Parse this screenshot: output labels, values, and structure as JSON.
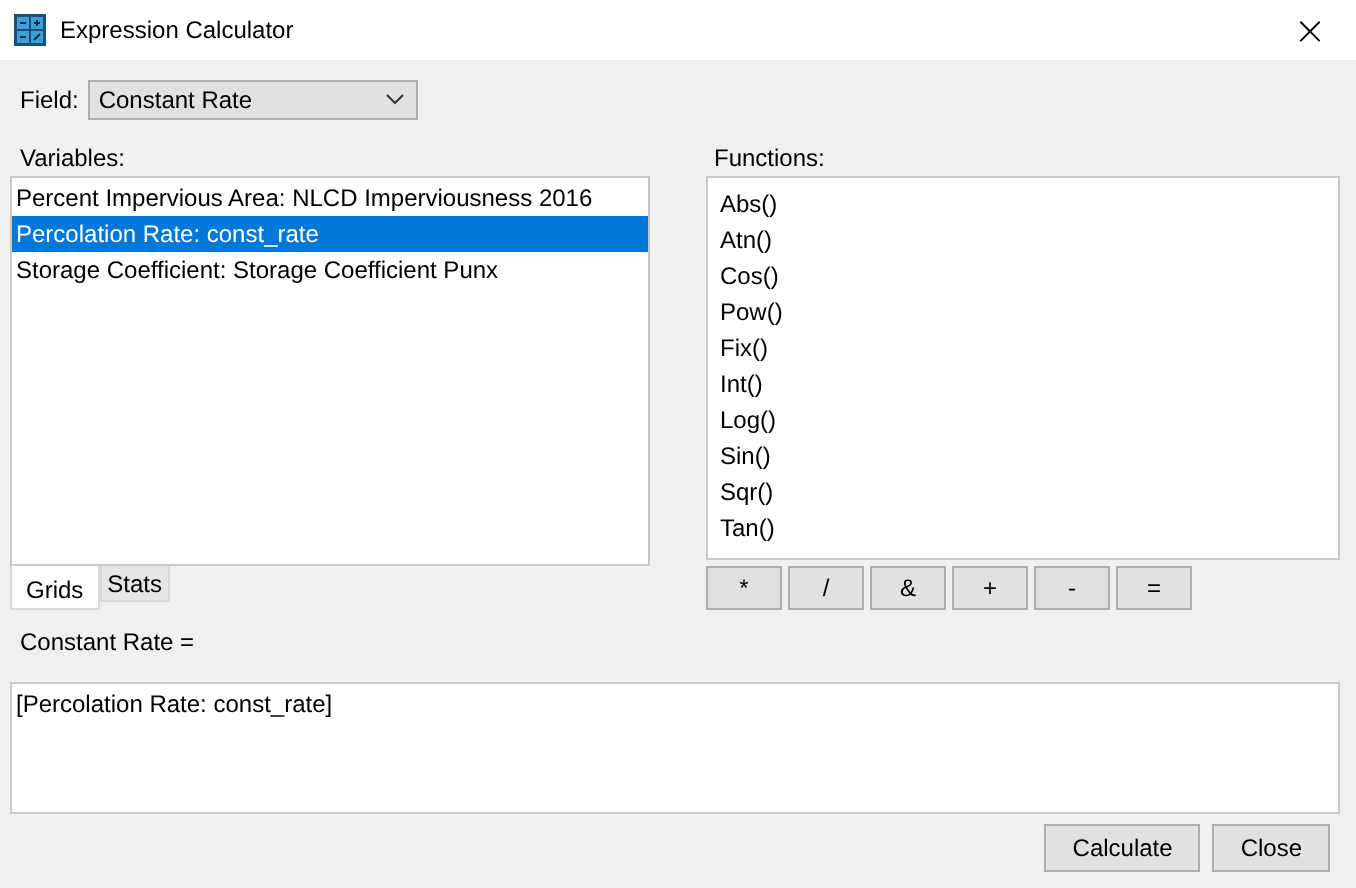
{
  "window": {
    "title": "Expression Calculator",
    "close": "×"
  },
  "field": {
    "label": "Field:",
    "value": "Constant Rate"
  },
  "variables": {
    "label": "Variables:",
    "items": [
      {
        "text": "Percent Impervious Area: NLCD Imperviousness 2016",
        "selected": false
      },
      {
        "text": "Percolation Rate: const_rate",
        "selected": true
      },
      {
        "text": "Storage Coefficient: Storage Coefficient Punx",
        "selected": false
      }
    ]
  },
  "tabs": [
    {
      "label": "Grids",
      "selected": true
    },
    {
      "label": "Stats",
      "selected": false
    }
  ],
  "functions": {
    "label": "Functions:",
    "items": [
      "Abs()",
      "Atn()",
      "Cos()",
      "Pow()",
      "Fix()",
      "Int()",
      "Log()",
      "Sin()",
      "Sqr()",
      "Tan()"
    ]
  },
  "operators": [
    "*",
    "/",
    "&",
    "+",
    "-",
    "="
  ],
  "expression": {
    "label": "Constant Rate =",
    "value": "[Percolation Rate: const_rate]"
  },
  "buttons": [
    "Calculate",
    "Close"
  ]
}
